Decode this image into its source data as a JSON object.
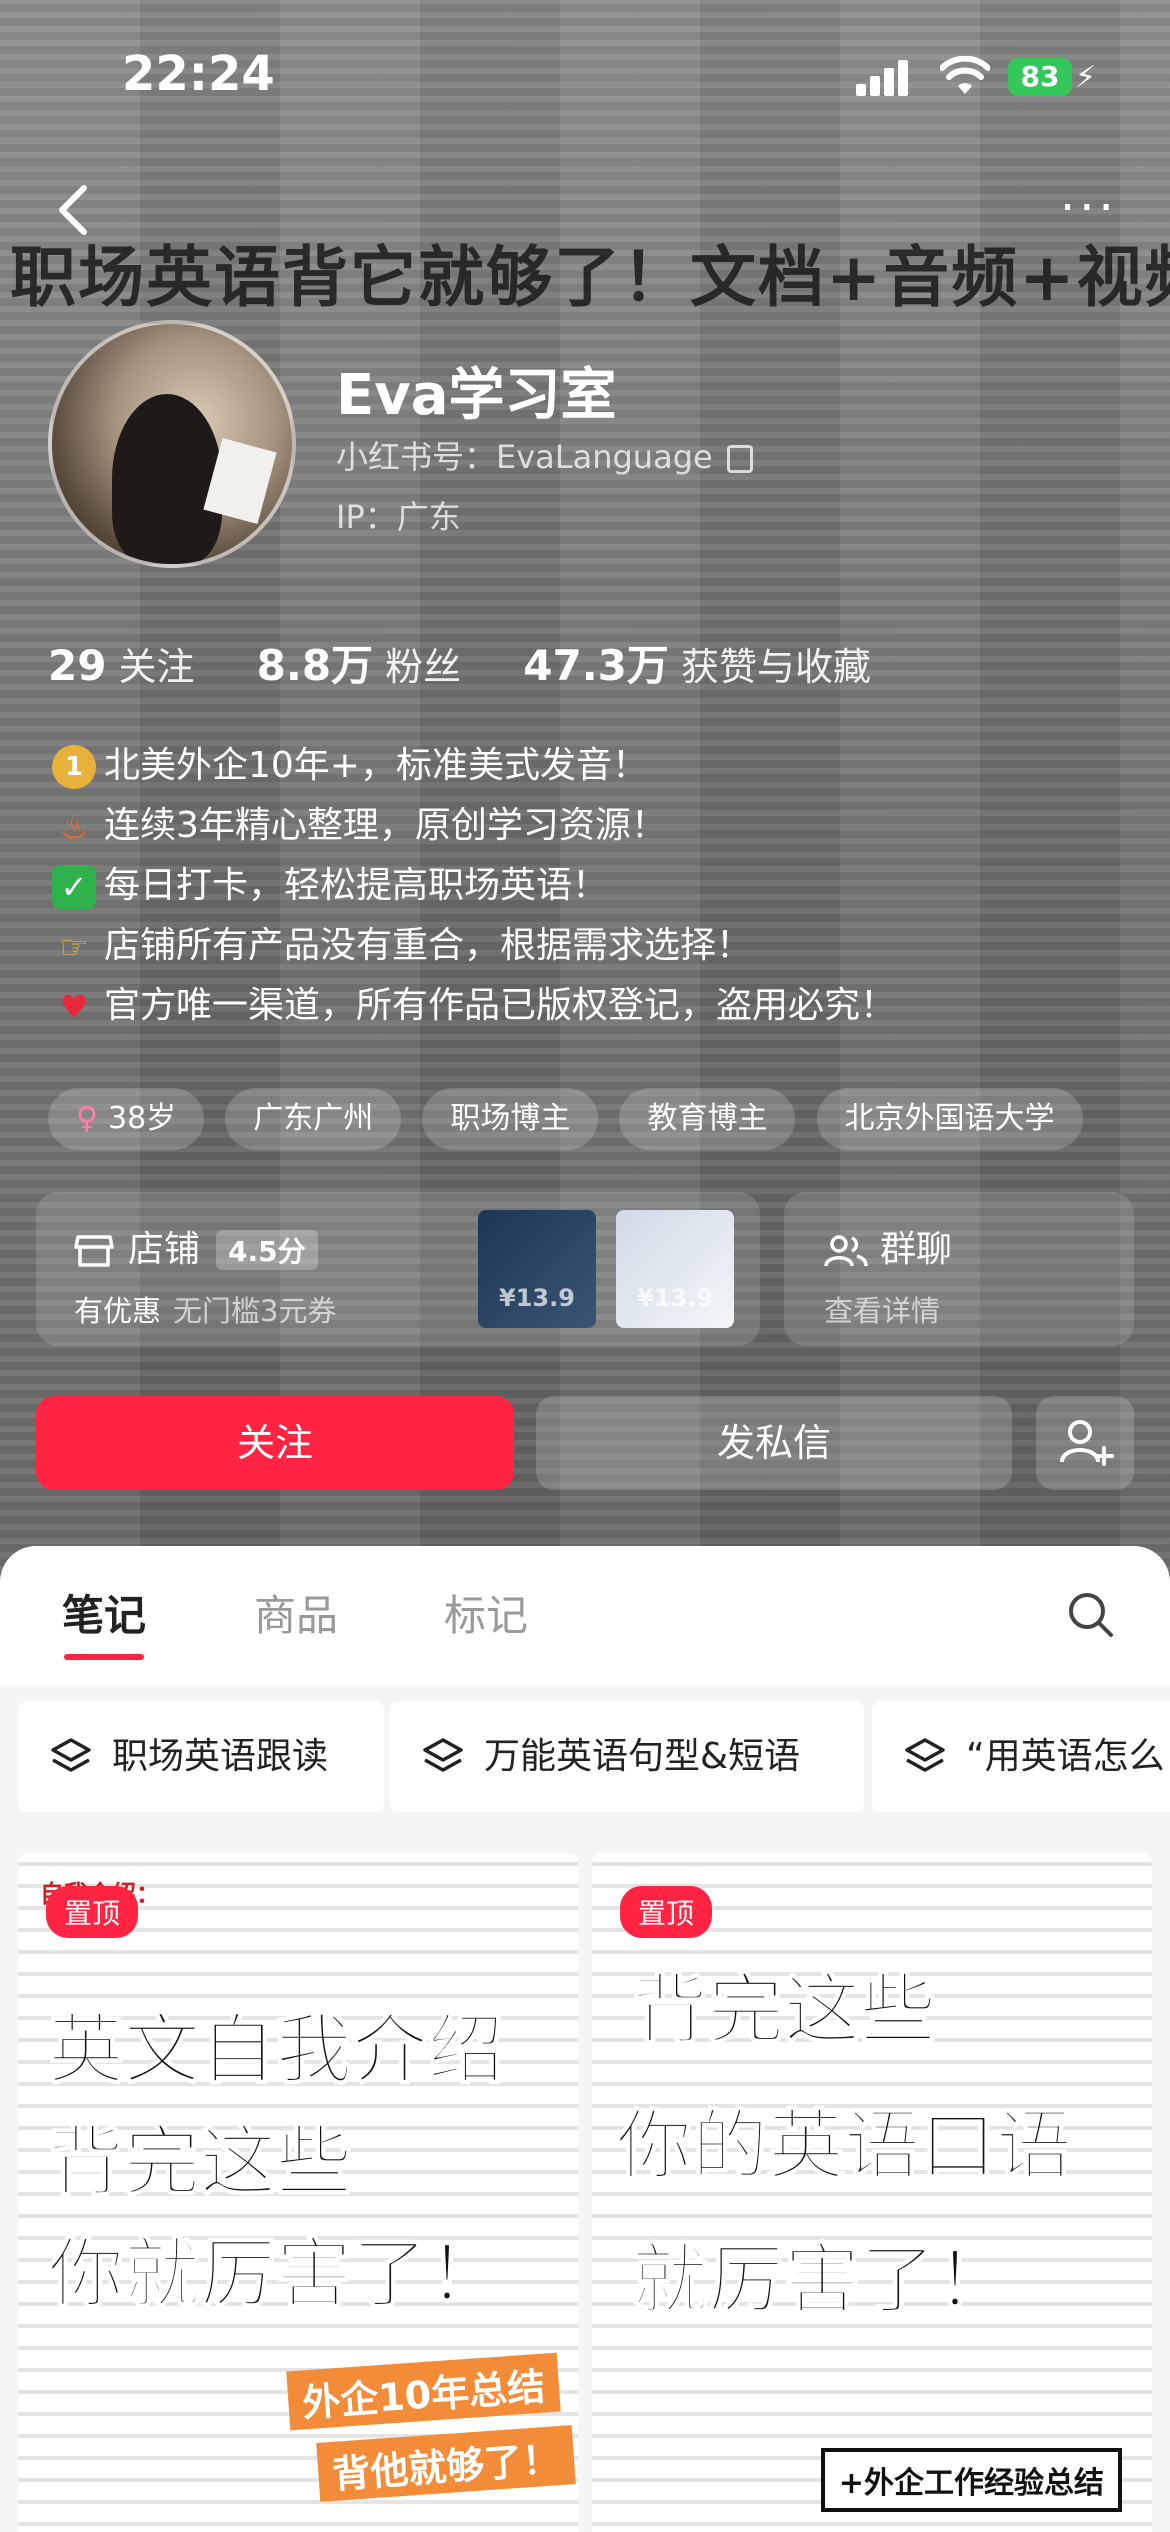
{
  "status_bar": {
    "time": "22:24",
    "battery": "83"
  },
  "banner_text": "职场英语背它就够了！文档+音频+视频",
  "profile": {
    "name": "Eva学习室",
    "redbook_id": "小红书号：EvaLanguage",
    "ip": "IP：广东"
  },
  "stats": [
    {
      "value": "29",
      "label": "关注"
    },
    {
      "value": "8.8万",
      "label": "粉丝"
    },
    {
      "value": "47.3万",
      "label": "获赞与收藏"
    }
  ],
  "bio": [
    {
      "icon": "medal-icon",
      "text": "北美外企10年+，标准美式发音！"
    },
    {
      "icon": "fire-icon",
      "text": "连续3年精心整理，原创学习资源！"
    },
    {
      "icon": "check-icon",
      "text": "每日打卡，轻松提高职场英语！"
    },
    {
      "icon": "pointing-hand-icon",
      "text": "店铺所有产品没有重合，根据需求选择！"
    },
    {
      "icon": "heart-icon",
      "text": "官方唯一渠道，所有作品已版权登记，盗用必究！"
    }
  ],
  "tags": [
    "38岁",
    "广东广州",
    "职场博主",
    "教育博主",
    "北京外国语大学"
  ],
  "shop": {
    "title": "店铺",
    "score": "4.5分",
    "promo": "有优惠",
    "promo_detail": "无门槛3元券",
    "product_prices": [
      "¥13.9",
      "¥13.9"
    ]
  },
  "group_chat": {
    "title": "群聊",
    "subtitle": "查看详情"
  },
  "actions": {
    "follow": "关注",
    "message": "发私信"
  },
  "tabs": [
    "笔记",
    "商品",
    "标记"
  ],
  "collections": [
    "职场英语跟读",
    "万能英语句型&短语",
    "“用英语怎么"
  ],
  "posts": [
    {
      "pin": "置顶",
      "header": "自我介绍：",
      "lines": [
        "英文自我介绍",
        "背完这些",
        "你就厉害了！"
      ],
      "ribbon1": "外企10年总结",
      "ribbon2": "背他就够了！"
    },
    {
      "pin": "置顶",
      "lines": [
        "背完这些",
        "你的英语口语",
        "就厉害了！"
      ],
      "stamp": "+外企工作经验总结"
    }
  ],
  "colors": {
    "accent": "#ff2442",
    "sheet": "#ffffff"
  }
}
